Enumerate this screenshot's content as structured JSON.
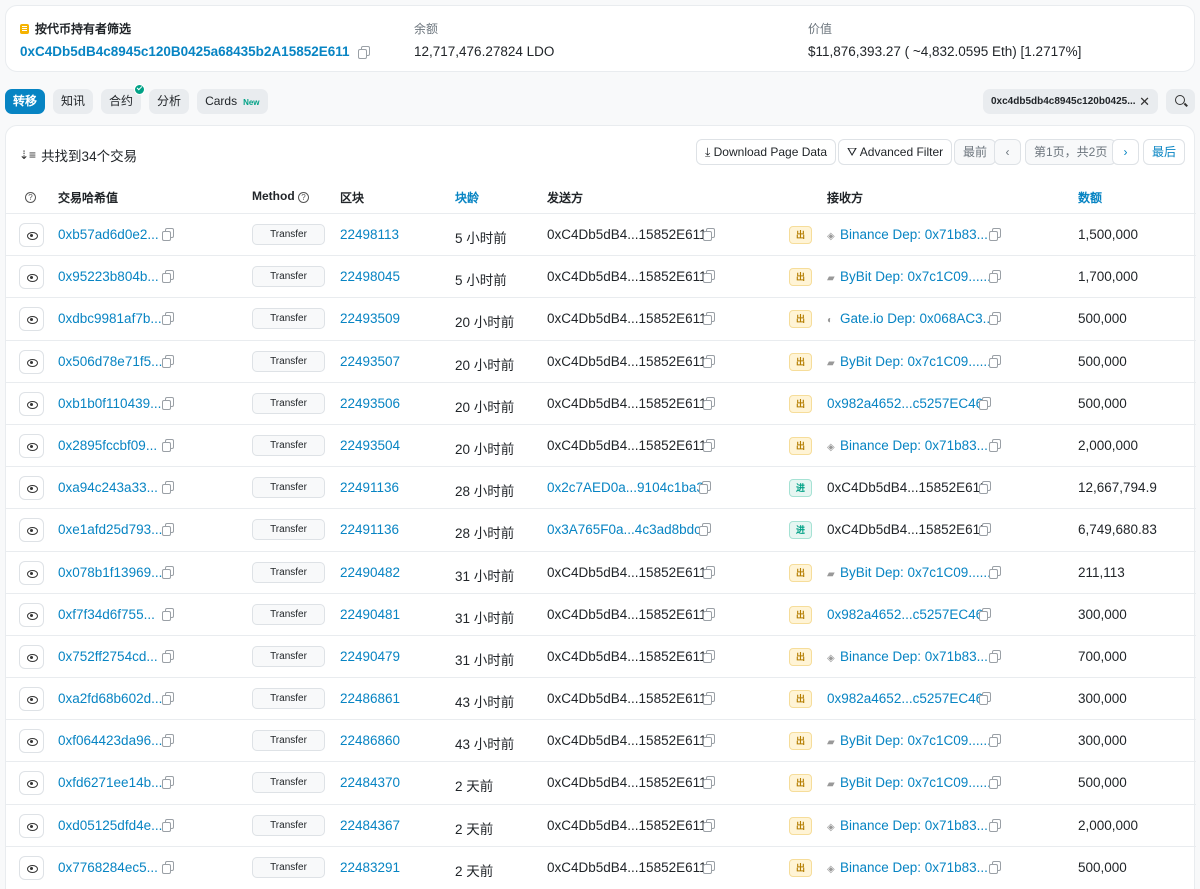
{
  "summary": {
    "filter_label": "按代币持有者筛选",
    "address": "0xC4Db5dB4c8945c120B0425a68435b2A15852E611",
    "balance_label": "余额",
    "balance": "12,717,476.27824 LDO",
    "value_label": "价值",
    "value": "$11,876,393.27 ( ~4,832.0595 Eth) [1.2717%]"
  },
  "tabs": [
    {
      "label": "转移",
      "active": true
    },
    {
      "label": "知讯"
    },
    {
      "label": "合约",
      "verified": true
    },
    {
      "label": "分析"
    },
    {
      "label": "Cards",
      "badge": "New"
    }
  ],
  "address_filter": "0xc4db5db4c8945c120b0425...",
  "toolbar": {
    "found_text": "共找到34个交易",
    "download": "Download Page Data",
    "advanced_filter": "Advanced Filter",
    "first": "最前",
    "page": "第1页，共2页",
    "last": "最后"
  },
  "columns": {
    "hash": "交易哈希值",
    "method": "Method",
    "block": "区块",
    "age": "块龄",
    "from": "发送方",
    "to": "接收方",
    "amount": "数额"
  },
  "rows": [
    {
      "hash": "0xb57ad6d0e2...",
      "method": "Transfer",
      "block": "22498113",
      "age": "5 小时前",
      "from": "0xC4Db5dB4...15852E611",
      "from_link": false,
      "dir": "出",
      "to": "Binance Dep: 0x71b83...",
      "to_icon": "binance",
      "to_link": true,
      "amount": "1,500,000"
    },
    {
      "hash": "0x95223b804b...",
      "method": "Transfer",
      "block": "22498045",
      "age": "5 小时前",
      "from": "0xC4Db5dB4...15852E611",
      "from_link": false,
      "dir": "出",
      "to": "ByBit Dep: 0x7c1C09......",
      "to_icon": "bybit",
      "to_link": true,
      "amount": "1,700,000"
    },
    {
      "hash": "0xdbc9981af7b...",
      "method": "Transfer",
      "block": "22493509",
      "age": "20 小时前",
      "from": "0xC4Db5dB4...15852E611",
      "from_link": false,
      "dir": "出",
      "to": "Gate.io Dep: 0x068AC3...",
      "to_icon": "gate",
      "to_link": true,
      "amount": "500,000"
    },
    {
      "hash": "0x506d78e71f5...",
      "method": "Transfer",
      "block": "22493507",
      "age": "20 小时前",
      "from": "0xC4Db5dB4...15852E611",
      "from_link": false,
      "dir": "出",
      "to": "ByBit Dep: 0x7c1C09......",
      "to_icon": "bybit",
      "to_link": true,
      "amount": "500,000"
    },
    {
      "hash": "0xb1b0f110439...",
      "method": "Transfer",
      "block": "22493506",
      "age": "20 小时前",
      "from": "0xC4Db5dB4...15852E611",
      "from_link": false,
      "dir": "出",
      "to": "0x982a4652...c5257EC46",
      "to_icon": "",
      "to_link": true,
      "amount": "500,000"
    },
    {
      "hash": "0x2895fccbf09...",
      "method": "Transfer",
      "block": "22493504",
      "age": "20 小时前",
      "from": "0xC4Db5dB4...15852E611",
      "from_link": false,
      "dir": "出",
      "to": "Binance Dep: 0x71b83...",
      "to_icon": "binance",
      "to_link": true,
      "amount": "2,000,000"
    },
    {
      "hash": "0xa94c243a33...",
      "method": "Transfer",
      "block": "22491136",
      "age": "28 小时前",
      "from": "0x2c7AED0a...9104c1ba3",
      "from_link": true,
      "dir": "进",
      "to": "0xC4Db5dB4...15852E611",
      "to_icon": "",
      "to_link": false,
      "amount": "12,667,794.9"
    },
    {
      "hash": "0xe1afd25d793...",
      "method": "Transfer",
      "block": "22491136",
      "age": "28 小时前",
      "from": "0x3A765F0a...4c3ad8bdc",
      "from_link": true,
      "dir": "进",
      "to": "0xC4Db5dB4...15852E611",
      "to_icon": "",
      "to_link": false,
      "amount": "6,749,680.83"
    },
    {
      "hash": "0x078b1f13969...",
      "method": "Transfer",
      "block": "22490482",
      "age": "31 小时前",
      "from": "0xC4Db5dB4...15852E611",
      "from_link": false,
      "dir": "出",
      "to": "ByBit Dep: 0x7c1C09......",
      "to_icon": "bybit",
      "to_link": true,
      "amount": "211,113"
    },
    {
      "hash": "0xf7f34d6f755...",
      "method": "Transfer",
      "block": "22490481",
      "age": "31 小时前",
      "from": "0xC4Db5dB4...15852E611",
      "from_link": false,
      "dir": "出",
      "to": "0x982a4652...c5257EC46",
      "to_icon": "",
      "to_link": true,
      "amount": "300,000"
    },
    {
      "hash": "0x752ff2754cd...",
      "method": "Transfer",
      "block": "22490479",
      "age": "31 小时前",
      "from": "0xC4Db5dB4...15852E611",
      "from_link": false,
      "dir": "出",
      "to": "Binance Dep: 0x71b83...",
      "to_icon": "binance",
      "to_link": true,
      "amount": "700,000"
    },
    {
      "hash": "0xa2fd68b602d...",
      "method": "Transfer",
      "block": "22486861",
      "age": "43 小时前",
      "from": "0xC4Db5dB4...15852E611",
      "from_link": false,
      "dir": "出",
      "to": "0x982a4652...c5257EC46",
      "to_icon": "",
      "to_link": true,
      "amount": "300,000"
    },
    {
      "hash": "0xf064423da96...",
      "method": "Transfer",
      "block": "22486860",
      "age": "43 小时前",
      "from": "0xC4Db5dB4...15852E611",
      "from_link": false,
      "dir": "出",
      "to": "ByBit Dep: 0x7c1C09......",
      "to_icon": "bybit",
      "to_link": true,
      "amount": "300,000"
    },
    {
      "hash": "0xfd6271ee14b...",
      "method": "Transfer",
      "block": "22484370",
      "age": "2 天前",
      "from": "0xC4Db5dB4...15852E611",
      "from_link": false,
      "dir": "出",
      "to": "ByBit Dep: 0x7c1C09......",
      "to_icon": "bybit",
      "to_link": true,
      "amount": "500,000"
    },
    {
      "hash": "0xd05125dfd4e...",
      "method": "Transfer",
      "block": "22484367",
      "age": "2 天前",
      "from": "0xC4Db5dB4...15852E611",
      "from_link": false,
      "dir": "出",
      "to": "Binance Dep: 0x71b83...",
      "to_icon": "binance",
      "to_link": true,
      "amount": "2,000,000"
    },
    {
      "hash": "0x7768284ec5...",
      "method": "Transfer",
      "block": "22483291",
      "age": "2 天前",
      "from": "0xC4Db5dB4...15852E611",
      "from_link": false,
      "dir": "出",
      "to": "Binance Dep: 0x71b83...",
      "to_icon": "binance",
      "to_link": true,
      "amount": "500,000"
    }
  ]
}
